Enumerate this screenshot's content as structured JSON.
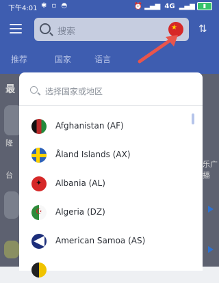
{
  "status": {
    "time": "下午4:01",
    "network": "4G"
  },
  "header": {
    "search_placeholder": "搜索"
  },
  "tabs": [
    "推荐",
    "国家",
    "语言"
  ],
  "background": {
    "section_label": "最",
    "snippet1": "隆",
    "snippet2": "台",
    "snippet3": "乐广播",
    "snippet4": "名",
    "snippet5": "音"
  },
  "modal": {
    "search_placeholder": "选择国家或地区",
    "countries": [
      {
        "label": "Afghanistan (AF)",
        "flag": "afghanistan-flag-icon"
      },
      {
        "label": "Åland Islands (AX)",
        "flag": "aland-islands-flag-icon"
      },
      {
        "label": "Albania (AL)",
        "flag": "albania-flag-icon"
      },
      {
        "label": "Algeria (DZ)",
        "flag": "algeria-flag-icon"
      },
      {
        "label": "American Samoa (AS)",
        "flag": "american-samoa-flag-icon"
      }
    ]
  },
  "colors": {
    "primary": "#3e5db0",
    "arrow": "#e8554c"
  }
}
